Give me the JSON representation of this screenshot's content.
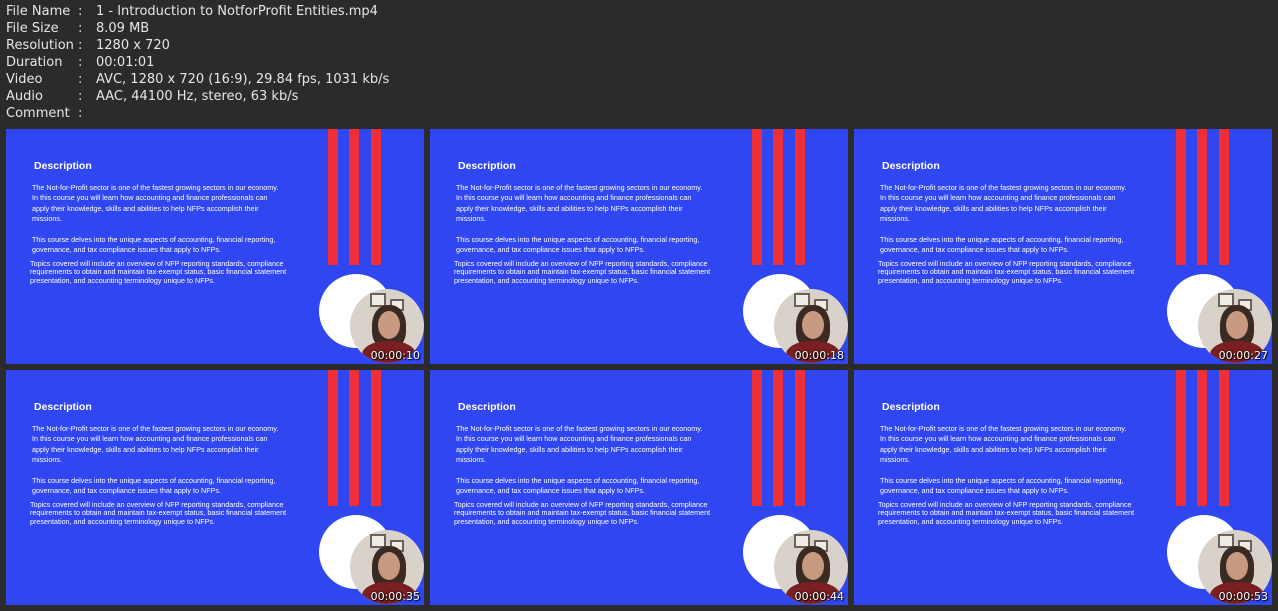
{
  "meta": [
    {
      "key": "File Name",
      "value": "1 - Introduction to NotforProfit Entities.mp4"
    },
    {
      "key": "File Size",
      "value": "8.09 MB"
    },
    {
      "key": "Resolution",
      "value": "1280 x 720"
    },
    {
      "key": "Duration",
      "value": "00:01:01"
    },
    {
      "key": "Video",
      "value": "AVC, 1280 x 720 (16:9), 29.84 fps, 1031 kb/s"
    },
    {
      "key": "Audio",
      "value": "AAC, 44100 Hz, stereo, 63 kb/s"
    },
    {
      "key": "Comment",
      "value": ""
    }
  ],
  "separator": ":",
  "slide": {
    "title": "Description",
    "para1": "The Not-for-Profit sector is one of the fastest growing sectors in our economy. In this course you will learn how accounting and finance professionals can apply their knowledge, skills and abilities to help NFPs accomplish their missions.",
    "para2": "This course delves into the unique aspects of accounting, financial reporting, governance, and tax compliance issues that apply to NFPs.",
    "para3": "Topics covered will include an overview of NFP reporting standards, compliance requirements to obtain and maintain tax-exempt status, basic financial statement presentation, and accounting terminology unique to NFPs."
  },
  "thumbnails": [
    {
      "timestamp": "00:00:10"
    },
    {
      "timestamp": "00:00:18"
    },
    {
      "timestamp": "00:00:27"
    },
    {
      "timestamp": "00:00:35"
    },
    {
      "timestamp": "00:00:44"
    },
    {
      "timestamp": "00:00:53"
    }
  ],
  "colors": {
    "slide_background": "#2f46f0",
    "bar": "#ee2f38"
  }
}
